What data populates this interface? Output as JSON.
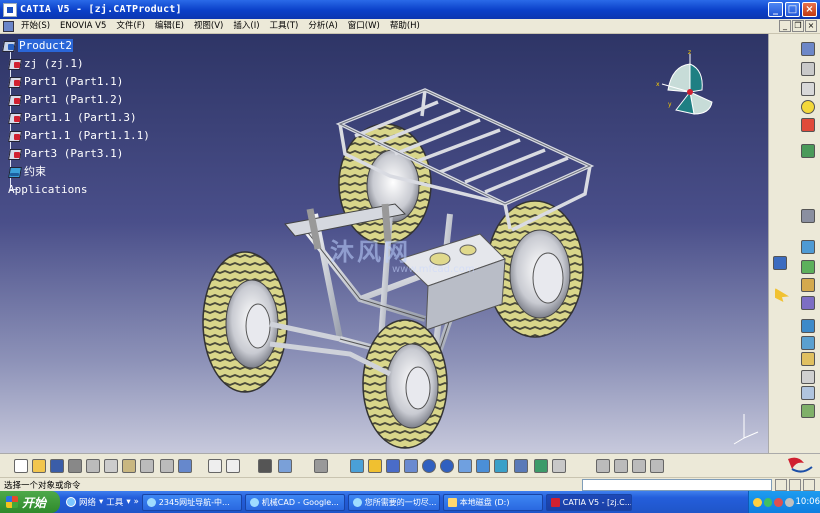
{
  "window": {
    "title": "CATIA V5 - [zj.CATProduct]"
  },
  "window_controls": {
    "minimize": "_",
    "maximize": "□",
    "close": "×"
  },
  "menu": {
    "items": [
      "开始(S)",
      "ENOVIA V5",
      "文件(F)",
      "编辑(E)",
      "视图(V)",
      "插入(I)",
      "工具(T)",
      "分析(A)",
      "窗口(W)",
      "帮助(H)"
    ],
    "mdi": {
      "minimize": "_",
      "restore": "❐",
      "close": "×"
    }
  },
  "tree": {
    "root": "Product2",
    "items": [
      {
        "label": "zj (zj.1)",
        "icon": "part-icon"
      },
      {
        "label": "Part1 (Part1.1)",
        "icon": "part-icon"
      },
      {
        "label": "Part1 (Part1.2)",
        "icon": "part-icon"
      },
      {
        "label": "Part1.1 (Part1.3)",
        "icon": "part-icon"
      },
      {
        "label": "Part1.1 (Part1.1.1)",
        "icon": "part-icon"
      },
      {
        "label": "Part3 (Part3.1)",
        "icon": "part-icon"
      },
      {
        "label": "约束",
        "icon": "constraints-icon"
      }
    ],
    "applications": "Applications"
  },
  "viewport": {
    "watermark": "沐风网",
    "watermark_url": "www.mfcad.com"
  },
  "status": {
    "prompt": "选择一个对象或命令",
    "command_value": ""
  },
  "taskbar": {
    "start": "开始",
    "quick_launch": [
      "网络",
      "工具"
    ],
    "tasks": [
      {
        "label": "2345网址导航-中...",
        "icon": "browser-icon"
      },
      {
        "label": "机械CAD - Google...",
        "icon": "chrome-icon"
      },
      {
        "label": "您所需要的一切尽...",
        "icon": "browser-icon"
      },
      {
        "label": "本地磁盘 (D:)",
        "icon": "folder-icon"
      },
      {
        "label": "CATIA V5 - [zj.C...",
        "icon": "catia-icon",
        "active": true
      }
    ],
    "clock": "10:06"
  },
  "colors": {
    "title_bar": "#0a3fc8",
    "selection": "#2a66d8",
    "viewport_top": "#2e3566",
    "viewport_bottom": "#c7c9dc",
    "tire_tread": "#e6e39a"
  }
}
